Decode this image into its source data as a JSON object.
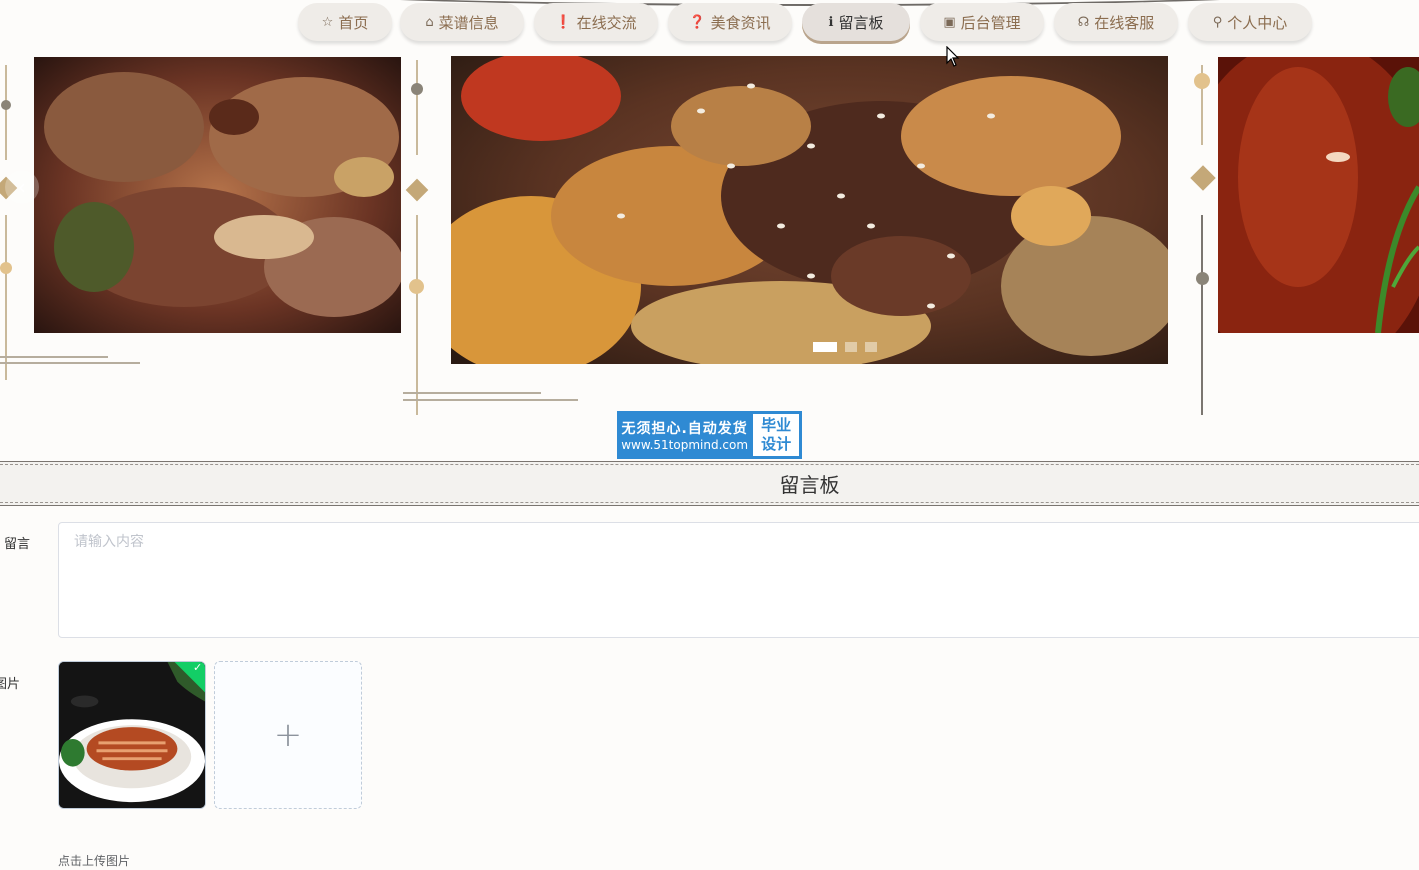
{
  "nav": {
    "items": [
      {
        "label": "首页",
        "icon": "star-icon",
        "glyph": "☆",
        "active": false
      },
      {
        "label": "菜谱信息",
        "icon": "bag-icon",
        "glyph": "⌂",
        "active": false
      },
      {
        "label": "在线交流",
        "icon": "exclamation-icon",
        "glyph": "❗",
        "active": false
      },
      {
        "label": "美食资讯",
        "icon": "question-icon",
        "glyph": "❓",
        "active": false
      },
      {
        "label": "留言板",
        "icon": "info-icon",
        "glyph": "ℹ",
        "active": true
      },
      {
        "label": "后台管理",
        "icon": "gift-icon",
        "glyph": "▣",
        "active": false
      },
      {
        "label": "在线客服",
        "icon": "headset-icon",
        "glyph": "☊",
        "active": false
      },
      {
        "label": "个人中心",
        "icon": "user-icon",
        "glyph": "⚲",
        "active": false
      }
    ]
  },
  "carousel": {
    "slide_count": 3,
    "active_index": 0,
    "prev_glyph": "‹"
  },
  "watermark": {
    "line1": "无须担心.自动发货",
    "line2": "www.51topmind.com",
    "right1": "毕业",
    "right2": "设计"
  },
  "section": {
    "title": "留言板"
  },
  "form": {
    "message_label": "留言",
    "message_placeholder": "请输入内容",
    "message_value": "",
    "image_label": "图片",
    "add_glyph": "+",
    "check_glyph": "✓",
    "upload_tip": "点击上传图片"
  },
  "colors": {
    "nav_text": "#8b6d4f",
    "accent_gold": "#c4a878",
    "upload_success": "#13ce66"
  }
}
